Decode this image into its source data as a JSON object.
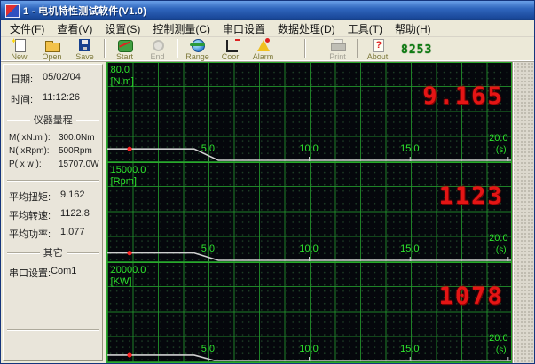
{
  "window": {
    "title": "1 - 电机特性测试软件(V1.0)"
  },
  "menu": {
    "items": [
      "文件(F)",
      "查看(V)",
      "设置(S)",
      "控制测量(C)",
      "串口设置",
      "数据处理(D)",
      "工具(T)",
      "帮助(H)"
    ]
  },
  "toolbar": {
    "buttons": [
      "New",
      "Open",
      "Save",
      "Start",
      "End",
      "Range",
      "Coor",
      "Alarm",
      "Print",
      "About"
    ],
    "counter": "8253"
  },
  "sidebar": {
    "date_label": "日期:",
    "date_value": "05/02/04",
    "time_label": "时间:",
    "time_value": "11:12:26",
    "range_group": "仪器量程",
    "rows": [
      {
        "label": "M( xN.m ):",
        "value": "300.0Nm"
      },
      {
        "label": "N( xRpm):",
        "value": "500Rpm"
      },
      {
        "label": "P( x w ):",
        "value": "15707.0W"
      }
    ],
    "avg": [
      {
        "label": "平均扭矩:",
        "value": "9.162"
      },
      {
        "label": "平均转速:",
        "value": "1122.8"
      },
      {
        "label": "平均功率:",
        "value": "1.077"
      }
    ],
    "other_group": "其它",
    "serial_label": "串口设置:",
    "serial_value": "Com1"
  },
  "chart_data": [
    {
      "type": "line",
      "name": "torque",
      "ylabel": "80.0",
      "yunit": "[N.m]",
      "ymax": 80,
      "ylim": [
        0,
        80
      ],
      "xlim": [
        0,
        20
      ],
      "xticks": [
        "5.0",
        "10.0",
        "15.0",
        "20.0"
      ],
      "xunit": "(s)",
      "reading": "9.165",
      "cursor_t": 1.1,
      "grid": true,
      "legend": "none",
      "series": [
        {
          "name": "torque-trace",
          "points": [
            [
              0,
              9.16
            ],
            [
              4.3,
              9.16
            ],
            [
              5.5,
              0
            ],
            [
              20,
              0
            ]
          ]
        }
      ]
    },
    {
      "type": "line",
      "name": "speed",
      "ylabel": "15000.0",
      "yunit": "[Rpm]",
      "ymax": 15000,
      "ylim": [
        0,
        15000
      ],
      "xlim": [
        0,
        20
      ],
      "xticks": [
        "5.0",
        "10.0",
        "15.0",
        "20.0"
      ],
      "xunit": "(s)",
      "reading": "1123",
      "cursor_t": 1.1,
      "grid": true,
      "legend": "none",
      "series": [
        {
          "name": "speed-trace",
          "points": [
            [
              0,
              1123
            ],
            [
              4.3,
              1123
            ],
            [
              5.5,
              0
            ],
            [
              20,
              0
            ]
          ]
        }
      ]
    },
    {
      "type": "line",
      "name": "power",
      "ylabel": "20000.0",
      "yunit": "[KW]",
      "ymax": 20000,
      "ylim": [
        0,
        20000
      ],
      "xlim": [
        0,
        20
      ],
      "xticks": [
        "5.0",
        "10.0",
        "15.0",
        "20.0"
      ],
      "xunit": "(s)",
      "reading": "1078",
      "cursor_t": 1.1,
      "grid": true,
      "legend": "none",
      "series": [
        {
          "name": "power-trace",
          "points": [
            [
              0,
              1078
            ],
            [
              4.3,
              1078
            ],
            [
              5.3,
              0
            ],
            [
              20,
              0
            ]
          ]
        }
      ]
    }
  ],
  "colors": {
    "titlebar_blue": "#2f66bd",
    "chrome": "#ece9d8",
    "chart_bg": "#05070c",
    "grid_green": "#22962c",
    "label_green": "#2de42d",
    "trace_gray": "#cfcfcf",
    "reading_red": "#e51515",
    "cursor_red": "#ff2222",
    "led_green": "#0e7c12"
  }
}
